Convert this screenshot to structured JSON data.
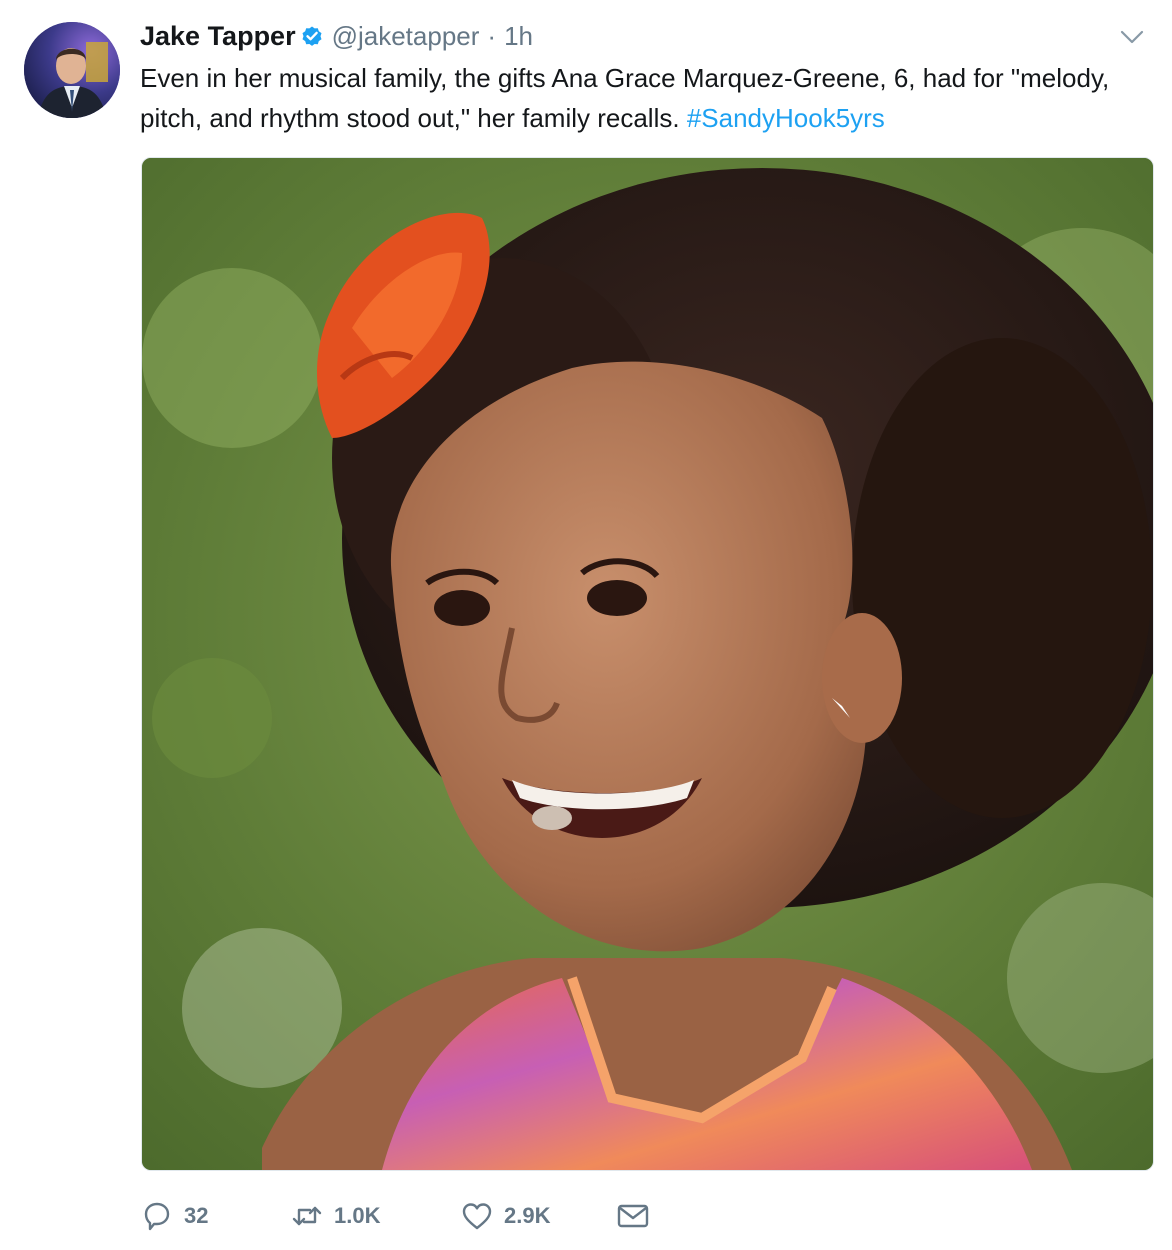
{
  "tweet": {
    "author": {
      "display_name": "Jake Tapper",
      "handle": "@jaketapper",
      "verified": true,
      "avatar_icon": "profile-photo"
    },
    "separator": "·",
    "timestamp": "1h",
    "text_main": "Even in her musical family, the gifts Ana Grace Marquez-Greene, 6, had for \"melody, pitch, and rhythm stood out,\" her family recalls. ",
    "hashtag": "#SandyHook5yrs",
    "media": {
      "type": "photo",
      "icon": "photo"
    },
    "actions": {
      "reply": {
        "icon": "reply-icon",
        "count": "32"
      },
      "retweet": {
        "icon": "retweet-icon",
        "count": "1.0K"
      },
      "like": {
        "icon": "heart-icon",
        "count": "2.9K"
      },
      "message": {
        "icon": "envelope-icon"
      }
    },
    "menu_icon": "chevron-down-icon"
  },
  "colors": {
    "text": "#14171a",
    "secondary": "#657786",
    "link": "#1da1f2",
    "verified": "#1da1f2",
    "border": "#e1e8ed"
  }
}
